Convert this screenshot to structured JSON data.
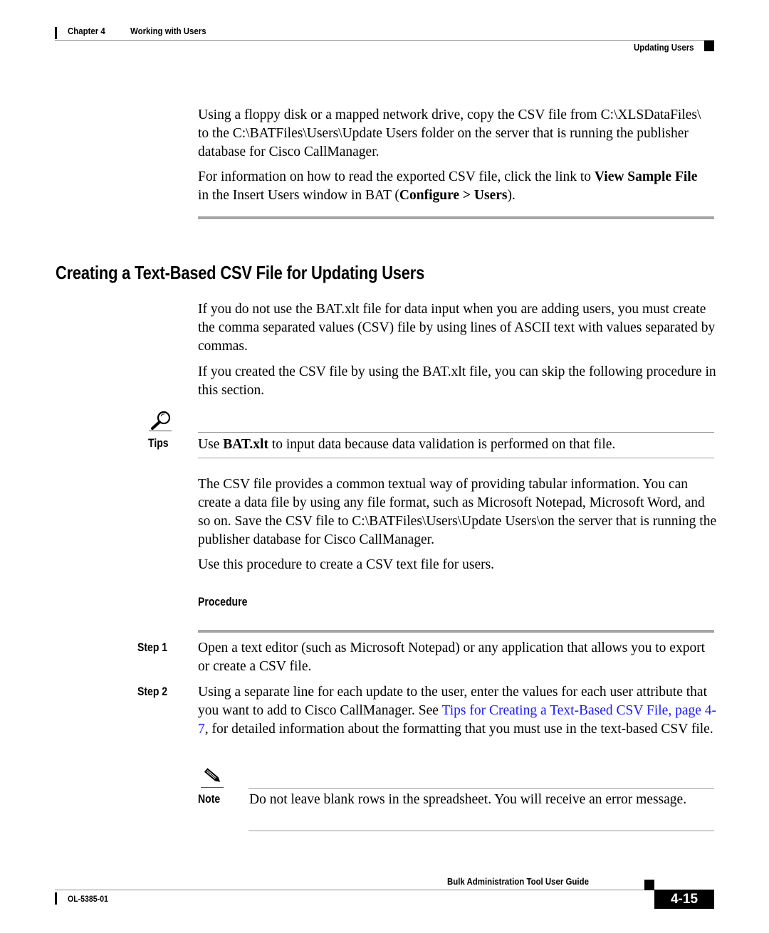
{
  "header": {
    "chapter_label": "Chapter 4",
    "chapter_title": "Working with Users",
    "section_label": "Updating Users"
  },
  "intro": {
    "para1": "Using a floppy disk or a mapped network drive, copy the CSV file from C:\\XLSDataFiles\\ to the C:\\BATFiles\\Users\\Update Users folder on the server that is running the publisher database for Cisco CallManager.",
    "para2": {
      "text_before": "For information on how to read the exported CSV file, click the link to ",
      "bold1": "View Sample File",
      "text_middle": " in the Insert Users window in BAT (",
      "bold2": "Configure > Users",
      "text_after": ")."
    }
  },
  "section": {
    "title": "Creating a Text-Based CSV File for Updating Users",
    "para1": "If you do not use the BAT.xlt file for data input when you are adding users, you must create the comma separated values (CSV) file by using lines of ASCII text with values separated by commas.",
    "para2": "If you created the CSV file by using the BAT.xlt file, you can skip the following procedure in this section.",
    "tip": {
      "icon": "magnifier-icon",
      "label": "Tips",
      "text_before": "Use ",
      "bold": "BAT.xlt",
      "text_after": " to input data because data validation is performed on that file."
    },
    "para3": "The CSV file provides a common textual way of providing tabular information. You can create a data file by using any file format, such as Microsoft Notepad, Microsoft Word, and so on. Save the CSV file to C:\\BATFiles\\Users\\Update Users\\on the server that is running the publisher database for Cisco CallManager.",
    "para4": "Use this procedure to create a CSV text file for users.",
    "procedure_label": "Procedure",
    "steps": [
      {
        "label": "Step 1",
        "text": "Open a text editor (such as Microsoft Notepad) or any application that allows you to export or create a CSV file."
      },
      {
        "label": "Step 2",
        "text_before": "Using a separate line for each update to the user, enter the values for each user attribute that you want to add to Cisco CallManager. See ",
        "link": "Tips for Creating a Text-Based CSV File, page 4-7",
        "text_after": ", for detailed information about the formatting that you must use in the text-based CSV file."
      }
    ],
    "note": {
      "icon": "pencil-icon",
      "label": "Note",
      "text": "Do not leave blank rows in the spreadsheet. You will receive an error message."
    }
  },
  "footer": {
    "guide_title": "Bulk Administration Tool User Guide",
    "doc_number": "OL-5385-01",
    "page_number": "4-15"
  },
  "colors": {
    "link": "#1a1aff",
    "rule": "#a6a6a6"
  }
}
